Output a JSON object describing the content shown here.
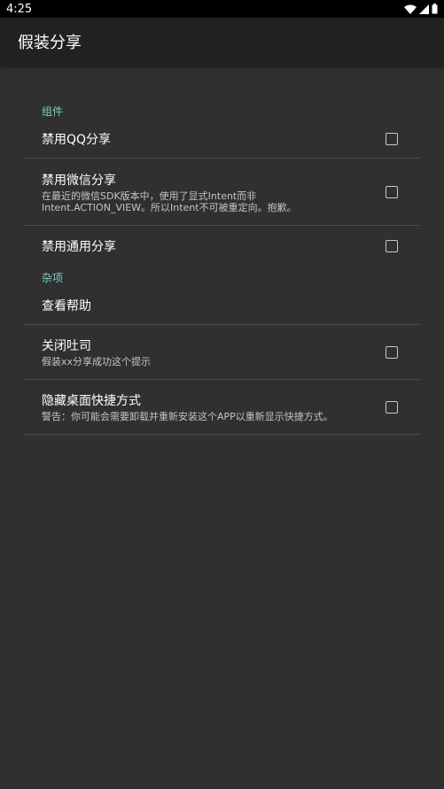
{
  "status_bar": {
    "time": "4:25"
  },
  "app_bar": {
    "title": "假装分享"
  },
  "sections": {
    "components": {
      "header": "组件",
      "disable_qq": {
        "title": "禁用QQ分享"
      },
      "disable_wechat": {
        "title": "禁用微信分享",
        "summary_line1": "在最近的微信SDK版本中，使用了显式Intent而非",
        "summary_line2": "Intent.ACTION_VIEW。所以Intent不可被重定向。抱歉。"
      },
      "disable_general": {
        "title": "禁用通用分享"
      }
    },
    "misc": {
      "header": "杂项",
      "view_help": {
        "title": "查看帮助"
      },
      "close_toast": {
        "title": "关闭吐司",
        "summary": "假装xx分享成功这个提示"
      },
      "hide_shortcut": {
        "title": "隐藏桌面快捷方式",
        "summary": "警告：你可能会需要卸载并重新安装这个APP以重新显示快捷方式。"
      }
    }
  },
  "colors": {
    "background": "#303030",
    "app_bar": "#212121",
    "accent": "#80cbc4",
    "divider": "#4a4a4a"
  },
  "icons": [
    "wifi-icon",
    "signal-icon",
    "battery-icon"
  ]
}
